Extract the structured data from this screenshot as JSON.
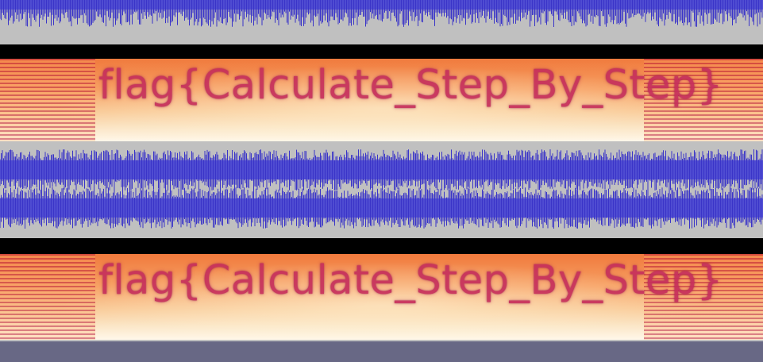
{
  "spectrogram": {
    "channel1_text": "flag{Calculate_Step_By_Step}",
    "channel2_text": "flag{Calculate_Step_By_Step}"
  },
  "colors": {
    "waveform": "#3a34c8",
    "waveform_rms": "#6464dc",
    "track_bg": "#c0c0c0",
    "separator": "#000000",
    "status_bar": "#686885",
    "spectrogram_text": "#c62f5c"
  }
}
